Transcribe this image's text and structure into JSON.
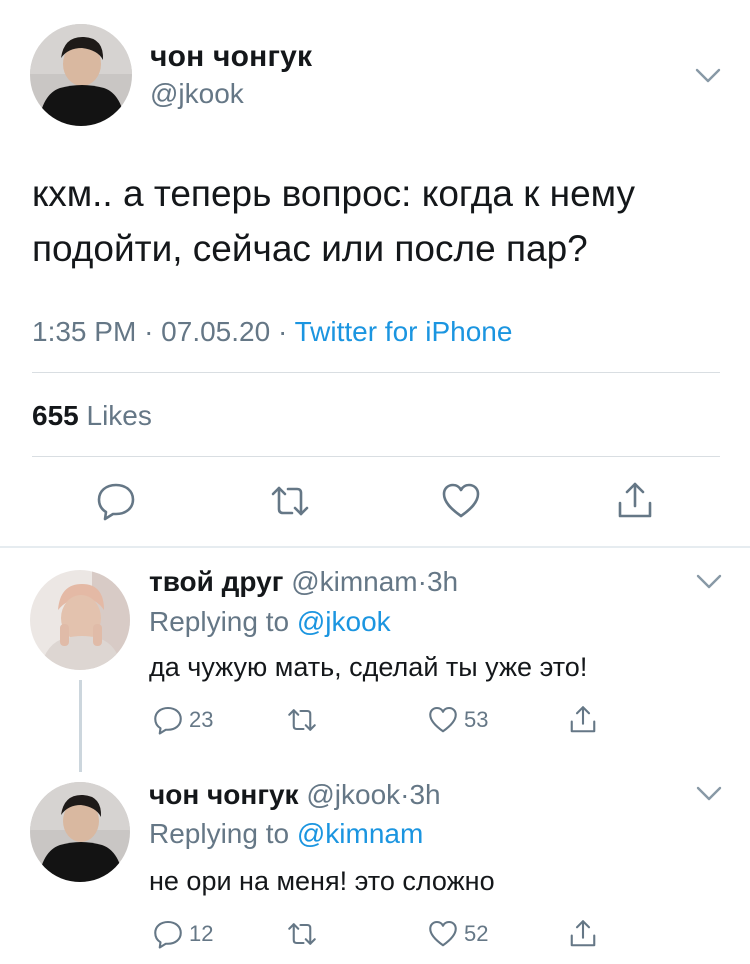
{
  "main_tweet": {
    "author_name": "чон чонгук",
    "author_handle": "@jkook",
    "text": "кхм.. а теперь вопрос: когда к нему подойти, сейчас или после пар?",
    "time": "1:35 PM",
    "date": "07.05.20",
    "separator": "·",
    "source": "Twitter for iPhone",
    "likes_count": "655",
    "likes_label": "Likes"
  },
  "replies": [
    {
      "author_name": "твой друг",
      "author_handle": "@kimnam",
      "time": "3h",
      "replying_prefix": "Replying to",
      "replying_to": "@jkook",
      "text": "да чужую мать, сделай ты уже это!",
      "reply_count": "23",
      "like_count": "53"
    },
    {
      "author_name": "чон чонгук",
      "author_handle": "@jkook",
      "time": "3h",
      "replying_prefix": "Replying to",
      "replying_to": "@kimnam",
      "text": "не ори на меня! это сложно",
      "reply_count": "12",
      "like_count": "52"
    }
  ],
  "colors": {
    "link": "#1b95e0",
    "muted": "#657786",
    "text": "#14171a",
    "divider": "#d9dee2"
  },
  "icons": [
    "chevron-down-icon",
    "reply-icon",
    "retweet-icon",
    "like-icon",
    "share-icon"
  ]
}
